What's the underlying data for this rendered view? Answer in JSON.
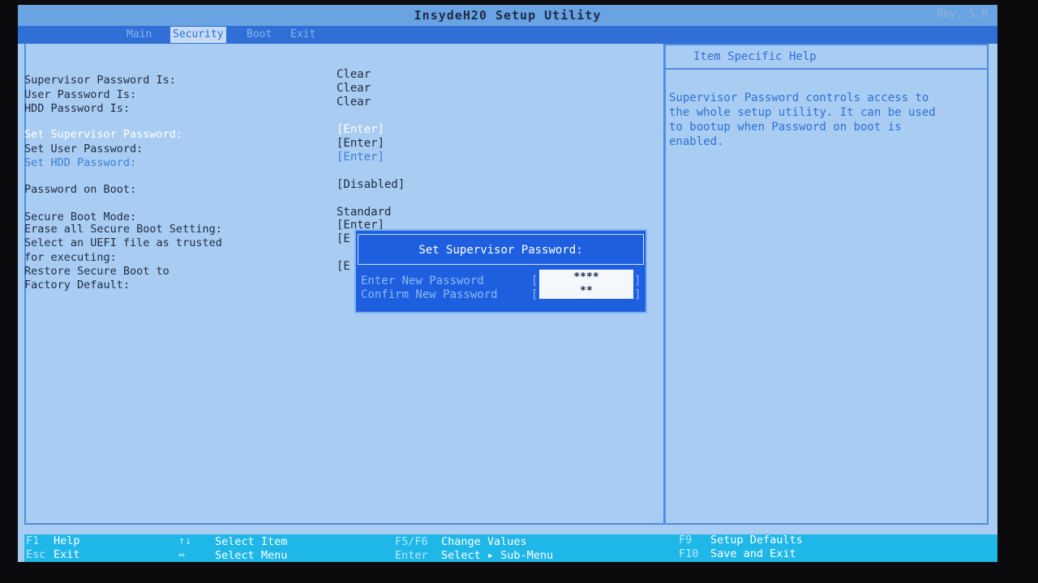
{
  "window": {
    "title": "InsydeH20 Setup Utility",
    "rev": "Rev. 5.0"
  },
  "menu": {
    "items": [
      "Main",
      "Security",
      "Boot",
      "Exit"
    ],
    "active": "Security"
  },
  "settings": {
    "supervisor_status_label": "Supervisor Password Is:",
    "supervisor_status_value": "Clear",
    "user_status_label": "User Password Is:",
    "user_status_value": "Clear",
    "hdd_status_label": "HDD Password Is:",
    "hdd_status_value": "Clear",
    "set_supervisor_label": "Set Supervisor Password:",
    "set_supervisor_value": "[Enter]",
    "set_user_label": "Set User Password:",
    "set_user_value": "[Enter]",
    "set_hdd_label": "Set HDD Password:",
    "set_hdd_value": "[Enter]",
    "password_boot_label": "Password on Boot:",
    "password_boot_value": "[Disabled]",
    "secure_boot_mode_label": "Secure Boot Mode:",
    "secure_boot_mode_value": "Standard",
    "erase_secure_boot_label": "Erase all Secure Boot Setting:",
    "erase_secure_boot_value": "[Enter]",
    "select_uefi_label_1": "Select an UEFI file as trusted",
    "select_uefi_label_2": "for executing:",
    "select_uefi_value": "[E",
    "restore_secure_label_1": "Restore Secure Boot to",
    "restore_secure_label_2": "Factory Default:",
    "restore_secure_value": "[E"
  },
  "help": {
    "title": "Item Specific Help",
    "text": "Supervisor Password controls access to\nthe whole setup utility. It can be used\nto bootup when Password on boot is\nenabled."
  },
  "dialog": {
    "title": "Set Supervisor Password:",
    "enter_label": "Enter New Password",
    "enter_value": "****",
    "confirm_label": "Confirm New Password",
    "confirm_value": "**"
  },
  "footer": {
    "f1_key": "F1",
    "f1_label": "Help",
    "esc_key": "Esc",
    "esc_label": "Exit",
    "arrows_ud_key": "↑↓",
    "arrows_ud_label": "Select Item",
    "arrows_lr_key": "↔",
    "arrows_lr_label": "Select Menu",
    "f5f6_key": "F5/F6",
    "f5f6_label": "Change Values",
    "enter_key": "Enter",
    "enter_label": "Select ▸ Sub-Menu",
    "f9_key": "F9",
    "f9_label": "Setup Defaults",
    "f10_key": "F10",
    "f10_label": "Save and Exit"
  }
}
